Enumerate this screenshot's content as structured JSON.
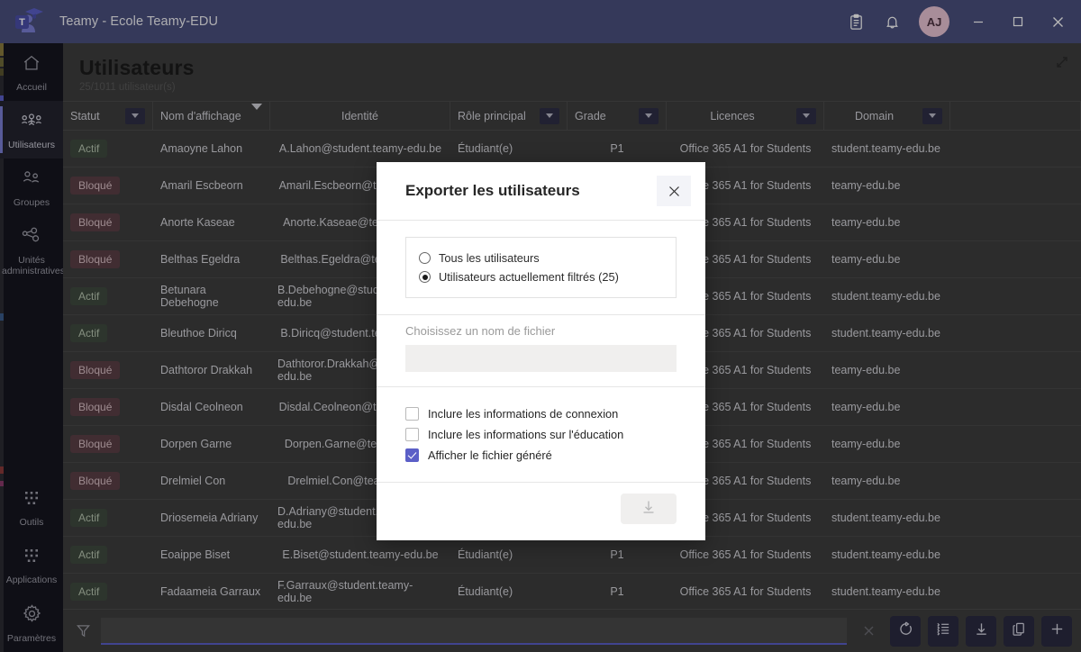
{
  "titlebar": {
    "app_title": "Teamy - Ecole Teamy-EDU",
    "logo_icon": "teamy-graduate-logo",
    "clipboard_icon": "clipboard-icon",
    "bell_icon": "bell-icon",
    "avatar_initials": "AJ",
    "minimize_icon": "minimize-icon",
    "maximize_icon": "maximize-icon",
    "close_icon": "close-icon",
    "accent": "#4a4f7d"
  },
  "sidebar": {
    "items": [
      {
        "label": "Accueil",
        "icon": "home-icon",
        "active": false
      },
      {
        "label": "Utilisateurs",
        "icon": "users-icon",
        "active": true
      },
      {
        "label": "Groupes",
        "icon": "groups-icon",
        "active": false
      },
      {
        "label": "Unités administratives",
        "icon": "org-units-icon",
        "active": false
      }
    ],
    "bottom_items": [
      {
        "label": "Outils",
        "icon": "grid-tools-icon"
      },
      {
        "label": "Applications",
        "icon": "grid-apps-icon"
      },
      {
        "label": "Paramètres",
        "icon": "gear-icon"
      }
    ]
  },
  "page": {
    "title": "Utilisateurs",
    "subtitle": "25/1011 utilisateur(s)",
    "expand_icon": "expand-diagonal-icon"
  },
  "table": {
    "columns": [
      {
        "key": "statut",
        "label": "Statut",
        "filter": true
      },
      {
        "key": "nom",
        "label": "Nom d'affichage",
        "sort": true
      },
      {
        "key": "identite",
        "label": "Identité",
        "filter": false
      },
      {
        "key": "role",
        "label": "Rôle principal",
        "filter": true
      },
      {
        "key": "grade",
        "label": "Grade",
        "filter": true
      },
      {
        "key": "licences",
        "label": "Licences",
        "filter": true
      },
      {
        "key": "domain",
        "label": "Domain",
        "filter": true
      }
    ],
    "rows": [
      {
        "statut": "Actif",
        "nom": "Amaoyne Lahon",
        "identite": "A.Lahon@student.teamy-edu.be",
        "role": "Étudiant(e)",
        "grade": "P1",
        "licences": "Office 365 A1 for Students",
        "domain": "student.teamy-edu.be"
      },
      {
        "statut": "Bloqué",
        "nom": "Amaril Escbeorn",
        "identite": "Amaril.Escbeorn@teamy-edu.be",
        "role": "",
        "grade": "",
        "licences": "Office 365 A1 for Students",
        "domain": "teamy-edu.be"
      },
      {
        "statut": "Bloqué",
        "nom": "Anorte Kaseae",
        "identite": "Anorte.Kaseae@teamy-edu.be",
        "role": "",
        "grade": "",
        "licences": "Office 365 A1 for Students",
        "domain": "teamy-edu.be"
      },
      {
        "statut": "Bloqué",
        "nom": "Belthas Egeldra",
        "identite": "Belthas.Egeldra@teamy-edu.be",
        "role": "",
        "grade": "",
        "licences": "Office 365 A1 for Students",
        "domain": "teamy-edu.be"
      },
      {
        "statut": "Actif",
        "nom": "Betunara Debehogne",
        "identite": "B.Debehogne@student.teamy-edu.be",
        "role": "",
        "grade": "",
        "licences": "Office 365 A1 for Students",
        "domain": "student.teamy-edu.be"
      },
      {
        "statut": "Actif",
        "nom": "Bleuthoe Diricq",
        "identite": "B.Diricq@student.teamy-edu.be",
        "role": "",
        "grade": "",
        "licences": "Office 365 A1 for Students",
        "domain": "student.teamy-edu.be"
      },
      {
        "statut": "Bloqué",
        "nom": "Dathtoror Drakkah",
        "identite": "Dathtoror.Drakkah@teamy-edu.be",
        "role": "",
        "grade": "",
        "licences": "Office 365 A1 for Students",
        "domain": "teamy-edu.be"
      },
      {
        "statut": "Bloqué",
        "nom": "Disdal Ceolneon",
        "identite": "Disdal.Ceolneon@teamy-edu.be",
        "role": "",
        "grade": "",
        "licences": "Office 365 A1 for Students",
        "domain": "teamy-edu.be"
      },
      {
        "statut": "Bloqué",
        "nom": "Dorpen Garne",
        "identite": "Dorpen.Garne@teamy-edu.be",
        "role": "",
        "grade": "",
        "licences": "Office 365 A1 for Students",
        "domain": "teamy-edu.be"
      },
      {
        "statut": "Bloqué",
        "nom": "Drelmiel Con",
        "identite": "Drelmiel.Con@teamy-edu.be",
        "role": "",
        "grade": "",
        "licences": "Office 365 A1 for Students",
        "domain": "teamy-edu.be"
      },
      {
        "statut": "Actif",
        "nom": "Driosemeia Adriany",
        "identite": "D.Adriany@student.teamy-edu.be",
        "role": "",
        "grade": "",
        "licences": "Office 365 A1 for Students",
        "domain": "student.teamy-edu.be"
      },
      {
        "statut": "Actif",
        "nom": "Eoaippe Biset",
        "identite": "E.Biset@student.teamy-edu.be",
        "role": "Étudiant(e)",
        "grade": "P1",
        "licences": "Office 365 A1 for Students",
        "domain": "student.teamy-edu.be"
      },
      {
        "statut": "Actif",
        "nom": "Fadaameia Garraux",
        "identite": "F.Garraux@student.teamy-edu.be",
        "role": "Étudiant(e)",
        "grade": "P1",
        "licences": "Office 365 A1 for Students",
        "domain": "student.teamy-edu.be"
      }
    ]
  },
  "bottombar": {
    "funnel_icon": "filter-funnel-icon",
    "search_value": "",
    "search_placeholder": "",
    "clear_icon": "clear-x-icon",
    "actions": [
      {
        "name": "refresh",
        "icon": "refresh-icon"
      },
      {
        "name": "columns",
        "icon": "list-settings-icon"
      },
      {
        "name": "export",
        "icon": "download-icon"
      },
      {
        "name": "duplicate",
        "icon": "copy-icon"
      },
      {
        "name": "add",
        "icon": "plus-icon"
      }
    ]
  },
  "modal": {
    "title": "Exporter les utilisateurs",
    "close_icon": "close-icon",
    "scope_options": [
      {
        "label": "Tous les utilisateurs",
        "selected": false
      },
      {
        "label": "Utilisateurs actuellement filtrés (25)",
        "selected": true
      }
    ],
    "filename_label": "Choisissez un nom de fichier",
    "filename_value": "",
    "filename_placeholder": "",
    "checkboxes": [
      {
        "label": "Inclure les informations de connexion",
        "checked": false
      },
      {
        "label": "Inclure les informations sur l'éducation",
        "checked": false
      },
      {
        "label": "Afficher le fichier généré",
        "checked": true
      }
    ],
    "download_icon": "download-icon",
    "accent": "#5b5fc7"
  }
}
